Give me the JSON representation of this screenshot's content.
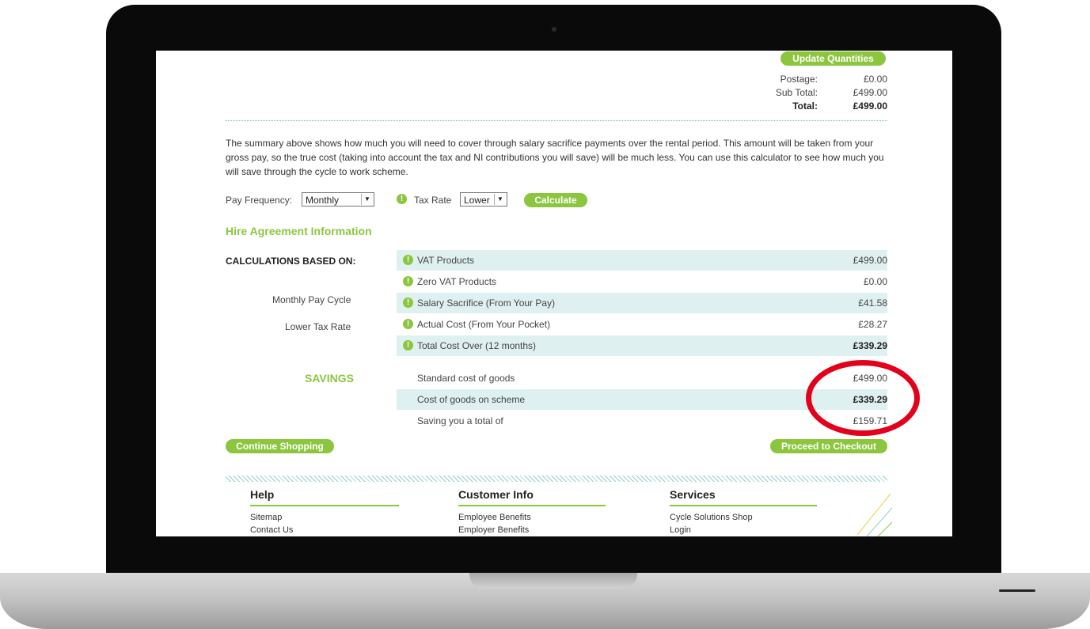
{
  "summary": {
    "update_label": "Update Quantities",
    "postage_label": "Postage:",
    "postage_value": "£0.00",
    "subtotal_label": "Sub Total:",
    "subtotal_value": "£499.00",
    "total_label": "Total:",
    "total_value": "£499.00"
  },
  "intro": "The summary above shows how much you will need to cover through salary sacrifice payments over the rental period. This amount will be taken from your gross pay, so the true cost (taking into account the tax and NI contributions you will save) will be much less. You can use this calculator to see how much you will save through the cycle to work scheme.",
  "calculator": {
    "pay_frequency_label": "Pay Frequency:",
    "pay_frequency_value": "Monthly",
    "tax_rate_label": "Tax Rate",
    "tax_rate_value": "Lower",
    "calculate_label": "Calculate"
  },
  "hire": {
    "title": "Hire Agreement Information",
    "based_on_label": "CALCULATIONS BASED ON:",
    "pay_cycle": "Monthly Pay Cycle",
    "tax_rate": "Lower Tax Rate",
    "rows": [
      {
        "label": "VAT Products",
        "value": "£499.00"
      },
      {
        "label": "Zero VAT Products",
        "value": "£0.00"
      },
      {
        "label": "Salary Sacrifice (From Your Pay)",
        "value": "£41.58"
      },
      {
        "label": "Actual Cost (From Your Pocket)",
        "value": "£28.27"
      },
      {
        "label": "Total Cost Over (12 months)",
        "value": "£339.29"
      }
    ]
  },
  "savings": {
    "title": "SAVINGS",
    "rows": [
      {
        "label": "Standard cost of goods",
        "value": "£499.00"
      },
      {
        "label": "Cost of goods on scheme",
        "value": "£339.29"
      },
      {
        "label": "Saving you a total of",
        "value": "£159.71"
      }
    ]
  },
  "actions": {
    "continue_label": "Continue Shopping",
    "checkout_label": "Proceed to Checkout"
  },
  "footer": {
    "columns": [
      {
        "title": "Help",
        "links": [
          "Sitemap",
          "Contact Us"
        ]
      },
      {
        "title": "Customer Info",
        "links": [
          "Employee Benefits",
          "Employer Benefits"
        ]
      },
      {
        "title": "Services",
        "links": [
          "Cycle Solutions Shop",
          "Login"
        ]
      }
    ]
  },
  "colors": {
    "accent": "#8cc63f",
    "row_shade": "#dff0f0",
    "highlight_circle": "#e3001b"
  },
  "icons": [
    "warning-icon",
    "dropdown-arrow-icon"
  ]
}
